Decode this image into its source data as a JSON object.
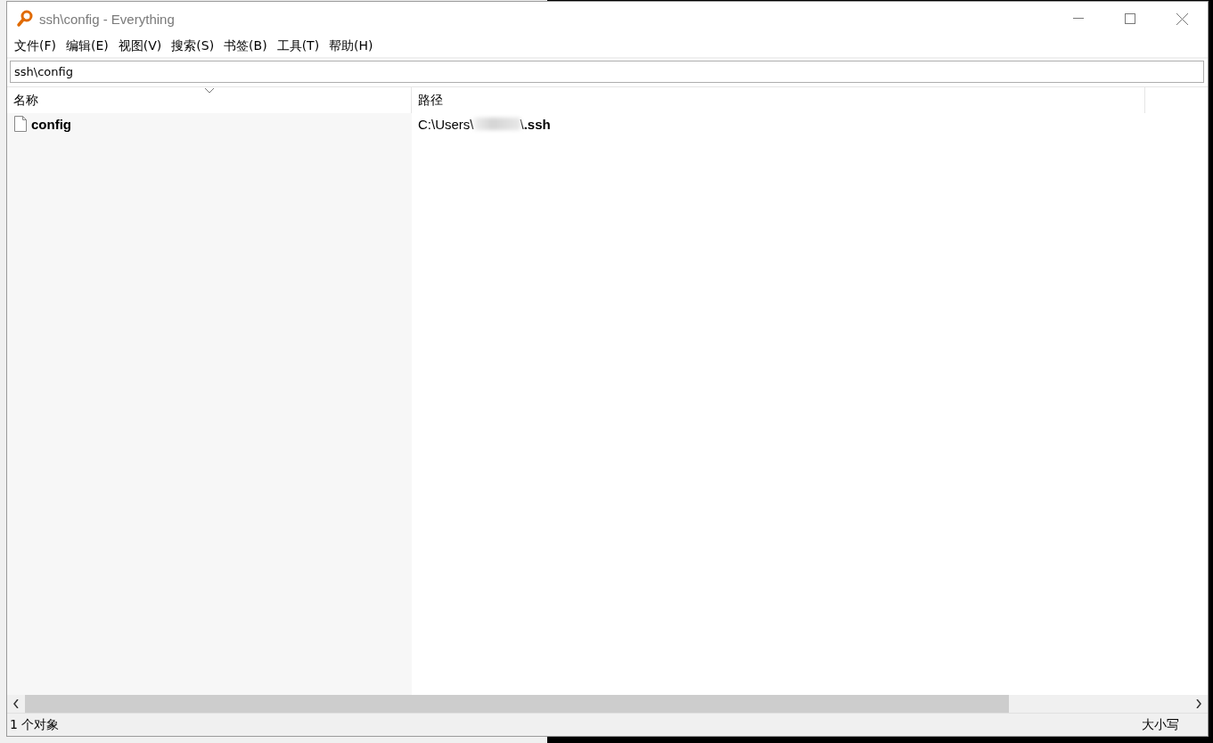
{
  "window": {
    "title": "ssh\\config - Everything"
  },
  "menu": [
    {
      "label": "文件(F)"
    },
    {
      "label": "编辑(E)"
    },
    {
      "label": "视图(V)"
    },
    {
      "label": "搜索(S)"
    },
    {
      "label": "书签(B)"
    },
    {
      "label": "工具(T)"
    },
    {
      "label": "帮助(H)"
    }
  ],
  "search": {
    "value": "ssh\\config"
  },
  "table": {
    "columns": [
      {
        "label": "名称",
        "sorted": true
      },
      {
        "label": "路径",
        "sorted": false
      }
    ],
    "rows": [
      {
        "name": "config",
        "path_start": "C:\\Users\\",
        "path_redacted": true,
        "path_end": "\\**.ssh**"
      }
    ]
  },
  "status_bar": {
    "count": "1 个对象",
    "right": "大小写"
  }
}
